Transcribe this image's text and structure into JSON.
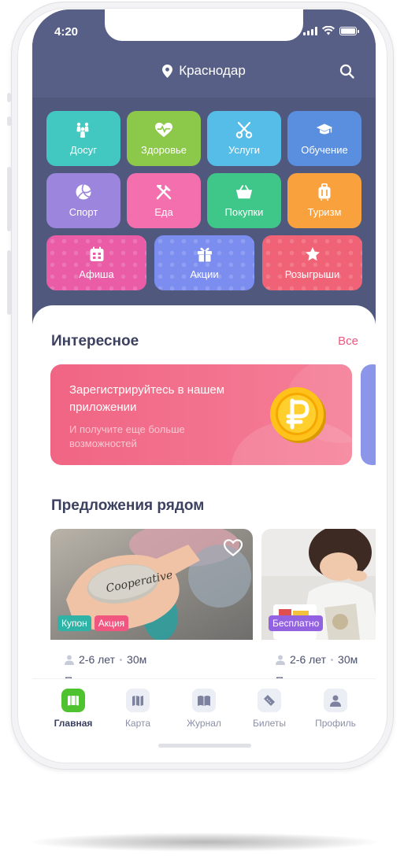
{
  "status": {
    "time": "4:20"
  },
  "header": {
    "city": "Краснодар"
  },
  "categories": [
    {
      "label": "Досуг",
      "color": "#42c8c0",
      "icon": "bowling-icon"
    },
    {
      "label": "Здоровье",
      "color": "#8cc84a",
      "icon": "heart-pulse-icon"
    },
    {
      "label": "Услуги",
      "color": "#56bde8",
      "icon": "scissors-icon"
    },
    {
      "label": "Обучение",
      "color": "#5a8fe0",
      "icon": "graduation-cap-icon"
    },
    {
      "label": "Спорт",
      "color": "#9b85dd",
      "icon": "volleyball-icon"
    },
    {
      "label": "Еда",
      "color": "#f46fae",
      "icon": "cutlery-icon"
    },
    {
      "label": "Покупки",
      "color": "#3fc789",
      "icon": "basket-icon"
    },
    {
      "label": "Туризм",
      "color": "#f9a23d",
      "icon": "luggage-icon"
    },
    {
      "label": "Афиша",
      "color": "#ea5ca6",
      "icon": "calendar-icon"
    },
    {
      "label": "Акции",
      "color": "#7c8df0",
      "icon": "gift-icon"
    },
    {
      "label": "Розыгрыши",
      "color": "#f06275",
      "icon": "star-icon"
    }
  ],
  "interesting": {
    "title": "Интересное",
    "all_link": "Все",
    "banner": {
      "title": "Зарегистрируйтесь в нашем приложении",
      "subtitle": "И получите еще больше возможностей"
    }
  },
  "nearby": {
    "title": "Предложения рядом",
    "offers": [
      {
        "badges": [
          {
            "text": "Купон",
            "color": "#2fb3a6"
          },
          {
            "text": "Акция",
            "color": "#f0567f"
          }
        ],
        "age": "2-6 лет",
        "duration": "30м",
        "image_text": "Cooperative",
        "title_cut": "Пример названия"
      },
      {
        "badges": [
          {
            "text": "Бесплатно",
            "color": "#9362e0"
          }
        ],
        "age": "2-6 лет",
        "duration": "30м",
        "title_cut": "Пример названия"
      }
    ]
  },
  "tabbar": [
    {
      "label": "Главная",
      "icon": "home-book-icon",
      "active": true
    },
    {
      "label": "Карта",
      "icon": "map-icon",
      "active": false
    },
    {
      "label": "Журнал",
      "icon": "journal-icon",
      "active": false
    },
    {
      "label": "Билеты",
      "icon": "ticket-icon",
      "active": false
    },
    {
      "label": "Профиль",
      "icon": "profile-icon",
      "active": false
    }
  ]
}
